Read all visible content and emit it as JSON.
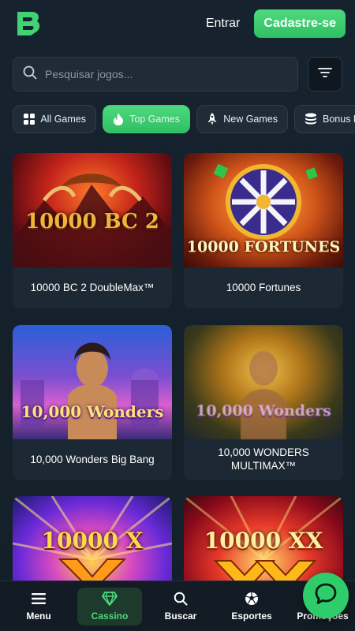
{
  "header": {
    "logo_icon": "brand-logo",
    "login_label": "Entrar",
    "signup_label": "Cadastre-se"
  },
  "search": {
    "placeholder": "Pesquisar jogos...",
    "icon": "search-icon",
    "filter_icon": "filter-icon"
  },
  "tabs": [
    {
      "label": "All Games",
      "icon": "grid-icon",
      "active": false
    },
    {
      "label": "Top Games",
      "icon": "flame-icon",
      "active": true
    },
    {
      "label": "New Games",
      "icon": "rocket-icon",
      "active": false
    },
    {
      "label": "Bonus Buy",
      "icon": "coins-icon",
      "active": false
    }
  ],
  "games": [
    {
      "title": "10000 BC 2 DoubleMax™",
      "art_text": "10000 BC 2"
    },
    {
      "title": "10000 Fortunes",
      "art_text": "10000 FORTUNES"
    },
    {
      "title": "10,000 Wonders Big Bang",
      "art_text": "10,000 Wonders"
    },
    {
      "title": "10,000 WONDERS MULTIMAX™",
      "art_text": "10,000 Wonders"
    },
    {
      "title": "",
      "art_text": "10000 X"
    },
    {
      "title": "",
      "art_text": "10000 XX"
    }
  ],
  "bottom_nav": [
    {
      "label": "Menu",
      "icon": "hamburger-icon",
      "active": false
    },
    {
      "label": "Cassino",
      "icon": "diamond-icon",
      "active": true
    },
    {
      "label": "Buscar",
      "icon": "search-icon",
      "active": false
    },
    {
      "label": "Esportes",
      "icon": "soccer-ball-icon",
      "active": false
    },
    {
      "label": "Promoções",
      "icon": "gift-icon",
      "active": false
    }
  ],
  "colors": {
    "accent": "#3fd374",
    "background": "#14202b",
    "card": "#1c2833"
  }
}
